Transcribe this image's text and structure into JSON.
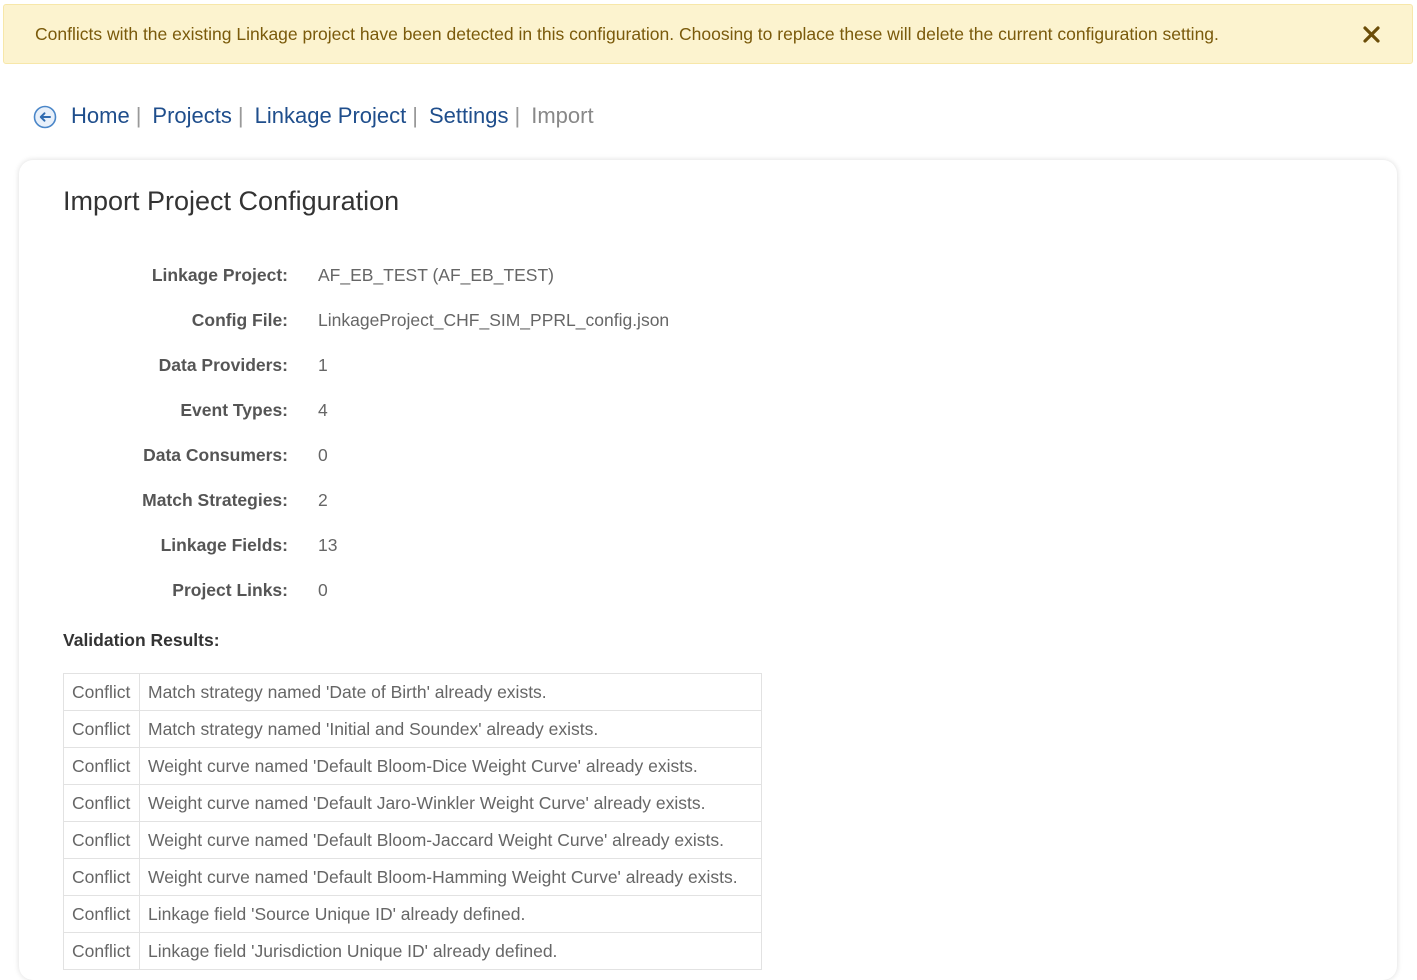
{
  "alert": {
    "message": "Conflicts with the existing Linkage project have been detected in this configuration. Choosing to replace these will delete the current configuration setting.",
    "close_icon": "close-icon",
    "bg_color": "#fcf3cf",
    "text_color": "#7a5a0b"
  },
  "breadcrumb": {
    "back_icon": "back-arrow-circle-icon",
    "items": [
      "Home",
      "Projects",
      "Linkage Project",
      "Settings"
    ],
    "separator": "|",
    "current": "Import"
  },
  "page": {
    "title": "Import Project Configuration"
  },
  "info": [
    {
      "label": "Linkage Project:",
      "value": "AF_EB_TEST (AF_EB_TEST)"
    },
    {
      "label": "Config File:",
      "value": "LinkageProject_CHF_SIM_PPRL_config.json"
    },
    {
      "label": "Data Providers:",
      "value": "1"
    },
    {
      "label": "Event Types:",
      "value": "4"
    },
    {
      "label": "Data Consumers:",
      "value": "0"
    },
    {
      "label": "Match Strategies:",
      "value": "2"
    },
    {
      "label": "Linkage Fields:",
      "value": "13"
    },
    {
      "label": "Project Links:",
      "value": "0"
    }
  ],
  "validation": {
    "title": "Validation Results:",
    "results": [
      {
        "type": "Conflict",
        "message": "Match strategy named 'Date of Birth' already exists."
      },
      {
        "type": "Conflict",
        "message": "Match strategy named 'Initial and Soundex' already exists."
      },
      {
        "type": "Conflict",
        "message": "Weight curve named 'Default Bloom-Dice Weight Curve' already exists."
      },
      {
        "type": "Conflict",
        "message": "Weight curve named 'Default Jaro-Winkler Weight Curve' already exists."
      },
      {
        "type": "Conflict",
        "message": "Weight curve named 'Default Bloom-Jaccard Weight Curve' already exists."
      },
      {
        "type": "Conflict",
        "message": "Weight curve named 'Default Bloom-Hamming Weight Curve' already exists."
      },
      {
        "type": "Conflict",
        "message": "Linkage field 'Source Unique ID' already defined."
      },
      {
        "type": "Conflict",
        "message": "Linkage field 'Jurisdiction Unique ID' already defined."
      }
    ]
  },
  "colors": {
    "link": "#1f4e8c",
    "accent_icon": "#4a86c8"
  }
}
